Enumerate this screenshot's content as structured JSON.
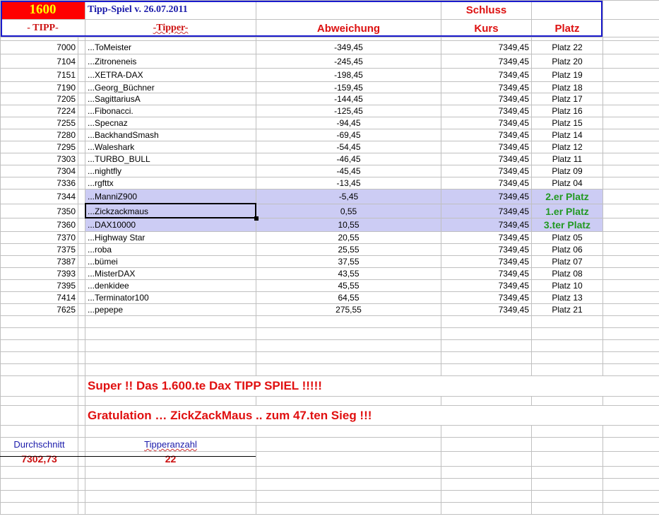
{
  "header": {
    "tipp_number": "1600",
    "title": "Tipp-Spiel v. 26.07.2011",
    "col_tipp": "- TIPP-",
    "col_tipper": "-Tipper-",
    "col_abweichung": "Abweichung",
    "col_schluss": "Schluss",
    "col_kurs": "Kurs",
    "col_platz": "Platz"
  },
  "rows": [
    {
      "tipp": "7000",
      "tipper": "...ToMeister",
      "abw": "-349,45",
      "kurs": "7349,45",
      "platz": "Platz 22"
    },
    {
      "tipp": "7104",
      "tipper": "...Zitroneneis",
      "abw": "-245,45",
      "kurs": "7349,45",
      "platz": "Platz 20"
    },
    {
      "tipp": "7151",
      "tipper": "...XETRA-DAX",
      "abw": "-198,45",
      "kurs": "7349,45",
      "platz": "Platz 19"
    },
    {
      "tipp": "7190",
      "tipper": "...Georg_Büchner",
      "abw": "-159,45",
      "kurs": "7349,45",
      "platz": "Platz 18"
    },
    {
      "tipp": "7205",
      "tipper": "...SagittariusA",
      "abw": "-144,45",
      "kurs": "7349,45",
      "platz": "Platz 17"
    },
    {
      "tipp": "7224",
      "tipper": "...Fibonacci.",
      "abw": "-125,45",
      "kurs": "7349,45",
      "platz": "Platz 16"
    },
    {
      "tipp": "7255",
      "tipper": "...Specnaz",
      "abw": "-94,45",
      "kurs": "7349,45",
      "platz": "Platz 15"
    },
    {
      "tipp": "7280",
      "tipper": "...BackhandSmash",
      "abw": "-69,45",
      "kurs": "7349,45",
      "platz": "Platz 14"
    },
    {
      "tipp": "7295",
      "tipper": "...Waleshark",
      "abw": "-54,45",
      "kurs": "7349,45",
      "platz": "Platz 12"
    },
    {
      "tipp": "7303",
      "tipper": "...TURBO_BULL",
      "abw": "-46,45",
      "kurs": "7349,45",
      "platz": "Platz 11"
    },
    {
      "tipp": "7304",
      "tipper": "...nightfly",
      "abw": "-45,45",
      "kurs": "7349,45",
      "platz": "Platz 09"
    },
    {
      "tipp": "7336",
      "tipper": "...rgfttx",
      "abw": "-13,45",
      "kurs": "7349,45",
      "platz": "Platz 04"
    },
    {
      "tipp": "7344",
      "tipper": "...ManniZ900",
      "abw": "-5,45",
      "kurs": "7349,45",
      "platz": "2.er Platz",
      "winner": true
    },
    {
      "tipp": "7350",
      "tipper": "...Zickzackmaus",
      "abw": "0,55",
      "kurs": "7349,45",
      "platz": "1.er Platz",
      "winner": true
    },
    {
      "tipp": "7360",
      "tipper": "...DAX10000",
      "abw": "10,55",
      "kurs": "7349,45",
      "platz": "3.ter Platz",
      "winner": true
    },
    {
      "tipp": "7370",
      "tipper": "...Highway Star",
      "abw": "20,55",
      "kurs": "7349,45",
      "platz": "Platz 05"
    },
    {
      "tipp": "7375",
      "tipper": "...roba",
      "abw": "25,55",
      "kurs": "7349,45",
      "platz": "Platz 06"
    },
    {
      "tipp": "7387",
      "tipper": "...bümei",
      "abw": "37,55",
      "kurs": "7349,45",
      "platz": "Platz 07"
    },
    {
      "tipp": "7393",
      "tipper": "...MisterDAX",
      "abw": "43,55",
      "kurs": "7349,45",
      "platz": "Platz 08"
    },
    {
      "tipp": "7395",
      "tipper": "...denkidee",
      "abw": "45,55",
      "kurs": "7349,45",
      "platz": "Platz 10"
    },
    {
      "tipp": "7414",
      "tipper": "...Terminator100",
      "abw": "64,55",
      "kurs": "7349,45",
      "platz": "Platz 13"
    },
    {
      "tipp": "7625",
      "tipper": "...pepepe",
      "abw": "275,55",
      "kurs": "7349,45",
      "platz": "Platz 21"
    }
  ],
  "messages": {
    "line1": "Super !! Das 1.600.te Dax TIPP SPIEL !!!!!",
    "line2": "Gratulation … ZickZackMaus .. zum    47.ten Sieg !!!"
  },
  "summary": {
    "avg_label": "Durchschnitt",
    "avg_value": "7302,73",
    "count_label": "Tipperanzahl",
    "count_value": "22"
  },
  "colors": {
    "highlight": "#ccccf4",
    "winner": "#229922",
    "accent_red": "#e01010",
    "header_blue": "#1a1acc"
  }
}
